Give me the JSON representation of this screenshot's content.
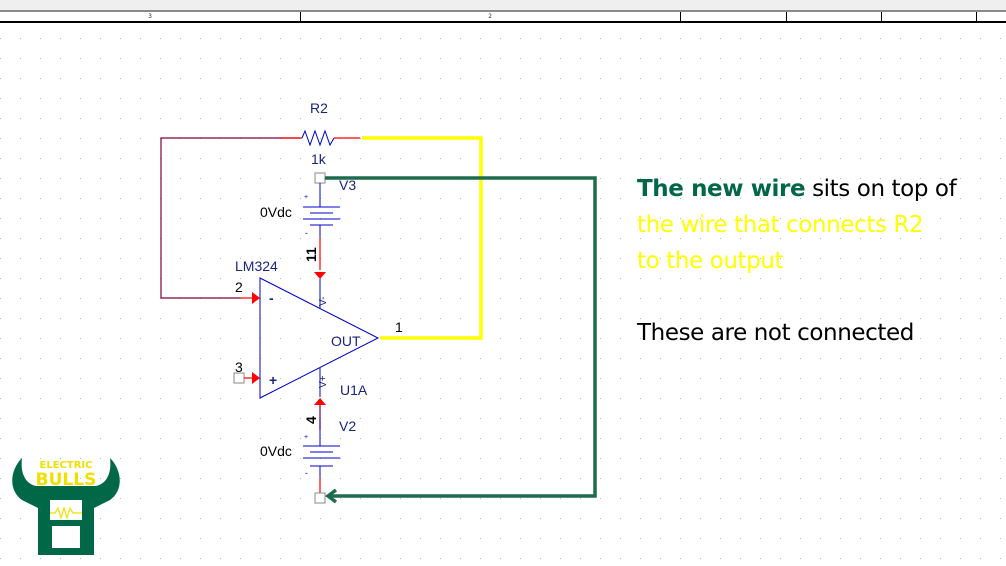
{
  "title_block": {
    "zone_labels": [
      "3",
      "2"
    ]
  },
  "colors": {
    "background": "#ffffff",
    "grid_dot": "#b8b8b8",
    "part_blue": "#0000cc",
    "pin_red": "#ff0000",
    "wire_maroon": "#800040",
    "highlight_yellow": "#ffff00",
    "new_wire_green": "#1e6b4e",
    "label_navy": "#1a237e",
    "text_black": "#000000",
    "logo_green": "#006747",
    "logo_gold": "#f0e000"
  },
  "schematic": {
    "resistor": {
      "ref": "R2",
      "value": "1k"
    },
    "sources": [
      {
        "ref": "V3",
        "value": "0Vdc",
        "plus": "+",
        "minus": "-"
      },
      {
        "ref": "V2",
        "value": "0Vdc",
        "plus": "+",
        "minus": "-"
      }
    ],
    "opamp": {
      "ref": "U1A",
      "part": "LM324",
      "output_label": "OUT",
      "inv_symbol": "-",
      "noninv_symbol": "+",
      "vminus_label": "V-",
      "vplus_label": "V+",
      "pins": {
        "inverting": "2",
        "non_inverting": "3",
        "output": "1",
        "v_minus": "11",
        "v_plus": "4"
      }
    }
  },
  "logo": {
    "line1": "ELECTRIC",
    "line2": "BULLS"
  },
  "annotation": {
    "line1_green": "The new wire",
    "line1_rest": " sits on top of",
    "line2_yellow": "the wire that connects R2",
    "line3_yellow": "to the output",
    "line4": "These are not connected"
  }
}
